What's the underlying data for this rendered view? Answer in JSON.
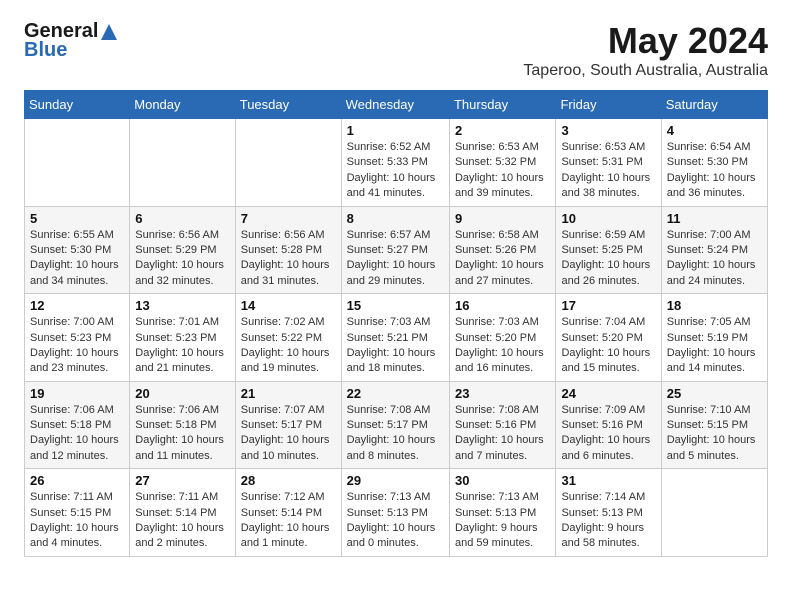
{
  "logo": {
    "text1": "General",
    "text2": "Blue"
  },
  "title": "May 2024",
  "location": "Taperoo, South Australia, Australia",
  "days_header": [
    "Sunday",
    "Monday",
    "Tuesday",
    "Wednesday",
    "Thursday",
    "Friday",
    "Saturday"
  ],
  "weeks": [
    [
      {
        "day": "",
        "info": ""
      },
      {
        "day": "",
        "info": ""
      },
      {
        "day": "",
        "info": ""
      },
      {
        "day": "1",
        "info": "Sunrise: 6:52 AM\nSunset: 5:33 PM\nDaylight: 10 hours\nand 41 minutes."
      },
      {
        "day": "2",
        "info": "Sunrise: 6:53 AM\nSunset: 5:32 PM\nDaylight: 10 hours\nand 39 minutes."
      },
      {
        "day": "3",
        "info": "Sunrise: 6:53 AM\nSunset: 5:31 PM\nDaylight: 10 hours\nand 38 minutes."
      },
      {
        "day": "4",
        "info": "Sunrise: 6:54 AM\nSunset: 5:30 PM\nDaylight: 10 hours\nand 36 minutes."
      }
    ],
    [
      {
        "day": "5",
        "info": "Sunrise: 6:55 AM\nSunset: 5:30 PM\nDaylight: 10 hours\nand 34 minutes."
      },
      {
        "day": "6",
        "info": "Sunrise: 6:56 AM\nSunset: 5:29 PM\nDaylight: 10 hours\nand 32 minutes."
      },
      {
        "day": "7",
        "info": "Sunrise: 6:56 AM\nSunset: 5:28 PM\nDaylight: 10 hours\nand 31 minutes."
      },
      {
        "day": "8",
        "info": "Sunrise: 6:57 AM\nSunset: 5:27 PM\nDaylight: 10 hours\nand 29 minutes."
      },
      {
        "day": "9",
        "info": "Sunrise: 6:58 AM\nSunset: 5:26 PM\nDaylight: 10 hours\nand 27 minutes."
      },
      {
        "day": "10",
        "info": "Sunrise: 6:59 AM\nSunset: 5:25 PM\nDaylight: 10 hours\nand 26 minutes."
      },
      {
        "day": "11",
        "info": "Sunrise: 7:00 AM\nSunset: 5:24 PM\nDaylight: 10 hours\nand 24 minutes."
      }
    ],
    [
      {
        "day": "12",
        "info": "Sunrise: 7:00 AM\nSunset: 5:23 PM\nDaylight: 10 hours\nand 23 minutes."
      },
      {
        "day": "13",
        "info": "Sunrise: 7:01 AM\nSunset: 5:23 PM\nDaylight: 10 hours\nand 21 minutes."
      },
      {
        "day": "14",
        "info": "Sunrise: 7:02 AM\nSunset: 5:22 PM\nDaylight: 10 hours\nand 19 minutes."
      },
      {
        "day": "15",
        "info": "Sunrise: 7:03 AM\nSunset: 5:21 PM\nDaylight: 10 hours\nand 18 minutes."
      },
      {
        "day": "16",
        "info": "Sunrise: 7:03 AM\nSunset: 5:20 PM\nDaylight: 10 hours\nand 16 minutes."
      },
      {
        "day": "17",
        "info": "Sunrise: 7:04 AM\nSunset: 5:20 PM\nDaylight: 10 hours\nand 15 minutes."
      },
      {
        "day": "18",
        "info": "Sunrise: 7:05 AM\nSunset: 5:19 PM\nDaylight: 10 hours\nand 14 minutes."
      }
    ],
    [
      {
        "day": "19",
        "info": "Sunrise: 7:06 AM\nSunset: 5:18 PM\nDaylight: 10 hours\nand 12 minutes."
      },
      {
        "day": "20",
        "info": "Sunrise: 7:06 AM\nSunset: 5:18 PM\nDaylight: 10 hours\nand 11 minutes."
      },
      {
        "day": "21",
        "info": "Sunrise: 7:07 AM\nSunset: 5:17 PM\nDaylight: 10 hours\nand 10 minutes."
      },
      {
        "day": "22",
        "info": "Sunrise: 7:08 AM\nSunset: 5:17 PM\nDaylight: 10 hours\nand 8 minutes."
      },
      {
        "day": "23",
        "info": "Sunrise: 7:08 AM\nSunset: 5:16 PM\nDaylight: 10 hours\nand 7 minutes."
      },
      {
        "day": "24",
        "info": "Sunrise: 7:09 AM\nSunset: 5:16 PM\nDaylight: 10 hours\nand 6 minutes."
      },
      {
        "day": "25",
        "info": "Sunrise: 7:10 AM\nSunset: 5:15 PM\nDaylight: 10 hours\nand 5 minutes."
      }
    ],
    [
      {
        "day": "26",
        "info": "Sunrise: 7:11 AM\nSunset: 5:15 PM\nDaylight: 10 hours\nand 4 minutes."
      },
      {
        "day": "27",
        "info": "Sunrise: 7:11 AM\nSunset: 5:14 PM\nDaylight: 10 hours\nand 2 minutes."
      },
      {
        "day": "28",
        "info": "Sunrise: 7:12 AM\nSunset: 5:14 PM\nDaylight: 10 hours\nand 1 minute."
      },
      {
        "day": "29",
        "info": "Sunrise: 7:13 AM\nSunset: 5:13 PM\nDaylight: 10 hours\nand 0 minutes."
      },
      {
        "day": "30",
        "info": "Sunrise: 7:13 AM\nSunset: 5:13 PM\nDaylight: 9 hours\nand 59 minutes."
      },
      {
        "day": "31",
        "info": "Sunrise: 7:14 AM\nSunset: 5:13 PM\nDaylight: 9 hours\nand 58 minutes."
      },
      {
        "day": "",
        "info": ""
      }
    ]
  ]
}
